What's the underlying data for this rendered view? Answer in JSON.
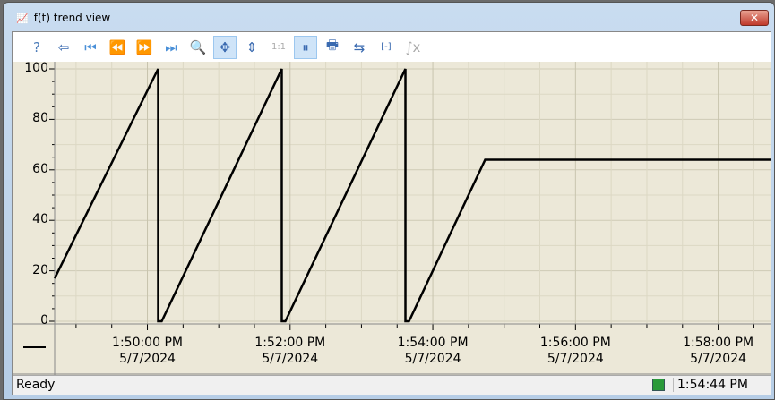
{
  "window": {
    "title": "f(t) trend view",
    "close_label": "✕"
  },
  "toolbar": {
    "buttons": [
      {
        "name": "help-icon",
        "glyph": "?",
        "active": false
      },
      {
        "name": "import-icon",
        "glyph": "⇦",
        "active": false
      },
      {
        "name": "first-icon",
        "glyph": "⏮",
        "active": false
      },
      {
        "name": "rewind-icon",
        "glyph": "⏪",
        "active": false
      },
      {
        "name": "fast-forward-icon",
        "glyph": "⏩",
        "active": false
      },
      {
        "name": "last-icon",
        "glyph": "⏭",
        "active": false
      },
      {
        "name": "zoom-icon",
        "glyph": "🔍",
        "active": false
      },
      {
        "name": "pan-icon",
        "glyph": "✥",
        "active": true
      },
      {
        "name": "y-scale-icon",
        "glyph": "⇕",
        "active": false
      },
      {
        "name": "one-to-one-icon",
        "glyph": "1:1",
        "active": false
      },
      {
        "name": "pause-icon",
        "glyph": "⏸",
        "active": true
      },
      {
        "name": "print-icon",
        "glyph": "🖶",
        "active": false
      },
      {
        "name": "cursor-icon",
        "glyph": "⇆",
        "active": false
      },
      {
        "name": "range-icon",
        "glyph": "[-]",
        "active": false
      },
      {
        "name": "integral-icon",
        "glyph": "∫x",
        "active": false
      }
    ]
  },
  "chart_data": {
    "type": "line",
    "ylim": [
      0,
      100
    ],
    "yticks": [
      0,
      20,
      40,
      60,
      80,
      100
    ],
    "xlim": [
      "1:48:42 PM",
      "1:58:44 PM"
    ],
    "xticks": [
      {
        "time": "1:50:00 PM",
        "date": "5/7/2024"
      },
      {
        "time": "1:52:00 PM",
        "date": "5/7/2024"
      },
      {
        "time": "1:54:00 PM",
        "date": "5/7/2024"
      },
      {
        "time": "1:56:00 PM",
        "date": "5/7/2024"
      },
      {
        "time": "1:58:00 PM",
        "date": "5/7/2024"
      }
    ],
    "grid": true,
    "color": "#000000",
    "background": "#ece8d8",
    "points": [
      [
        "1:48:42",
        17
      ],
      [
        "1:50:09",
        100
      ],
      [
        "1:50:09",
        0
      ],
      [
        "1:50:12",
        0
      ],
      [
        "1:51:53",
        100
      ],
      [
        "1:51:53",
        0
      ],
      [
        "1:51:56",
        0
      ],
      [
        "1:53:37",
        100
      ],
      [
        "1:53:37",
        0
      ],
      [
        "1:53:40",
        0
      ],
      [
        "1:54:44",
        64
      ],
      [
        "1:58:44",
        64
      ]
    ]
  },
  "status": {
    "text": "Ready",
    "time": "1:54:44 PM",
    "connection_icon": "network-icon"
  }
}
